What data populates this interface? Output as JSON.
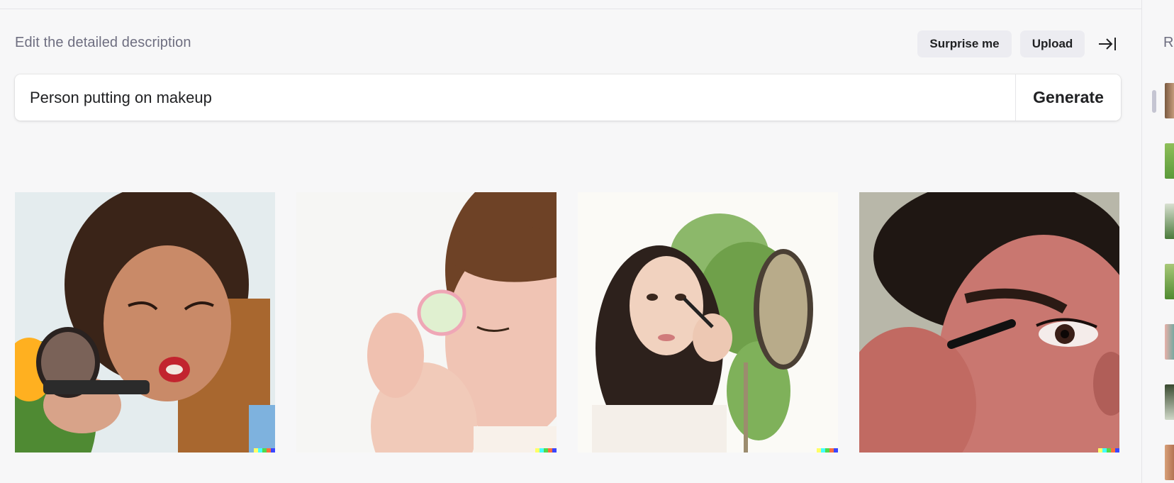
{
  "header": {
    "title": "Edit the detailed description",
    "surprise_label": "Surprise me",
    "upload_label": "Upload",
    "collapse_icon": "arrow-right-to-line-icon"
  },
  "prompt": {
    "value": "Person putting on makeup",
    "generate_label": "Generate"
  },
  "results": [
    {
      "name": "result-image-1",
      "subject": "woman with compact mirror"
    },
    {
      "name": "result-image-2",
      "subject": "woman applying cream"
    },
    {
      "name": "result-image-3",
      "subject": "woman with brush and hand mirror"
    },
    {
      "name": "result-image-4",
      "subject": "man applying mascara"
    }
  ],
  "signature_colors": [
    "#ffff66",
    "#42ffff",
    "#51da4c",
    "#ff6e3c",
    "#3c46ff"
  ],
  "right_panel": {
    "heading": "R",
    "thumb_count": 7
  }
}
